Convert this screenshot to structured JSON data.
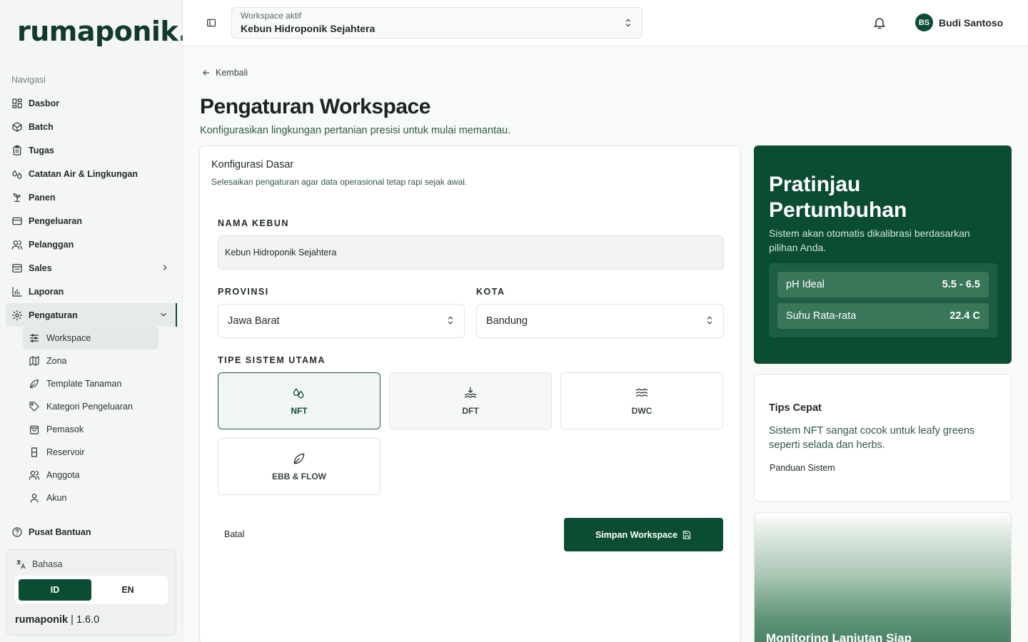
{
  "brand": {
    "logo_text": "rumaponik",
    "logo_dot": "."
  },
  "sidebar": {
    "caption": "Navigasi",
    "items": [
      {
        "label": "Dasbor",
        "icon": "dashboard-icon"
      },
      {
        "label": "Batch",
        "icon": "package-icon"
      },
      {
        "label": "Tugas",
        "icon": "clipboard-icon"
      },
      {
        "label": "Catatan Air & Lingkungan",
        "icon": "droplets-icon"
      },
      {
        "label": "Panen",
        "icon": "sprout-icon"
      },
      {
        "label": "Pengeluaran",
        "icon": "wallet-icon"
      },
      {
        "label": "Pelanggan",
        "icon": "users-icon"
      },
      {
        "label": "Sales",
        "icon": "receipt-icon"
      },
      {
        "label": "Laporan",
        "icon": "bar-chart-icon"
      },
      {
        "label": "Pengaturan",
        "icon": "settings-icon"
      }
    ],
    "sub_items": [
      {
        "label": "Workspace",
        "icon": "sliders-icon"
      },
      {
        "label": "Zona",
        "icon": "map-icon"
      },
      {
        "label": "Template Tanaman",
        "icon": "leaf-icon"
      },
      {
        "label": "Kategori Pengeluaran",
        "icon": "tag-icon"
      },
      {
        "label": "Pemasok",
        "icon": "shopping-bag-icon"
      },
      {
        "label": "Reservoir",
        "icon": "container-icon"
      },
      {
        "label": "Anggota",
        "icon": "users-icon"
      },
      {
        "label": "Akun",
        "icon": "user-icon"
      }
    ],
    "help": "Pusat Bantuan",
    "language": {
      "title": "Bahasa",
      "options": [
        "ID",
        "EN"
      ],
      "selected": "ID"
    },
    "version": {
      "app": "rumaponik",
      "separator": "|",
      "number": "1.6.0"
    }
  },
  "header": {
    "workspace_label": "Workspace aktif",
    "workspace_value": "Kebun Hidroponik Sejahtera",
    "user_initials": "BS",
    "user_name": "Budi Santoso"
  },
  "main": {
    "back": "Kembali",
    "title": "Pengaturan Workspace",
    "subtitle": "Konfigurasikan lingkungan pertanian presisi untuk mulai memantau.",
    "form": {
      "title": "Konfigurasi Dasar",
      "description": "Selesaikan pengaturan agar data operasional tetap rapi sejak awal.",
      "garden_name_label": "NAMA KEBUN",
      "garden_name_value": "Kebun Hidroponik Sejahtera",
      "province_label": "PROVINSI",
      "province_value": "Jawa Barat",
      "city_label": "KOTA",
      "city_value": "Bandung",
      "system_label": "TIPE SISTEM UTAMA",
      "systems": [
        "NFT",
        "DFT",
        "DWC",
        "EBB & FLOW"
      ],
      "selected_system": "NFT",
      "cancel": "Batal",
      "save": "Simpan Workspace"
    }
  },
  "growth": {
    "title": "Pratinjau Pertumbuhan",
    "description": "Sistem akan otomatis dikalibrasi berdasarkan pilihan Anda.",
    "metrics": [
      {
        "label": "pH Ideal",
        "value": "5.5 - 6.5"
      },
      {
        "label": "Suhu Rata-rata",
        "value": "22.4 C"
      }
    ]
  },
  "tips": {
    "title": "Tips Cepat",
    "body": "Sistem NFT sangat cocok untuk leafy greens seperti selada dan herbs.",
    "link": "Panduan Sistem"
  },
  "promo": {
    "title": "Monitoring Lanjutan Siap"
  },
  "colors": {
    "primary": "#0b4d33",
    "accent_text": "#2f5a45",
    "background": "#f8faf8"
  }
}
